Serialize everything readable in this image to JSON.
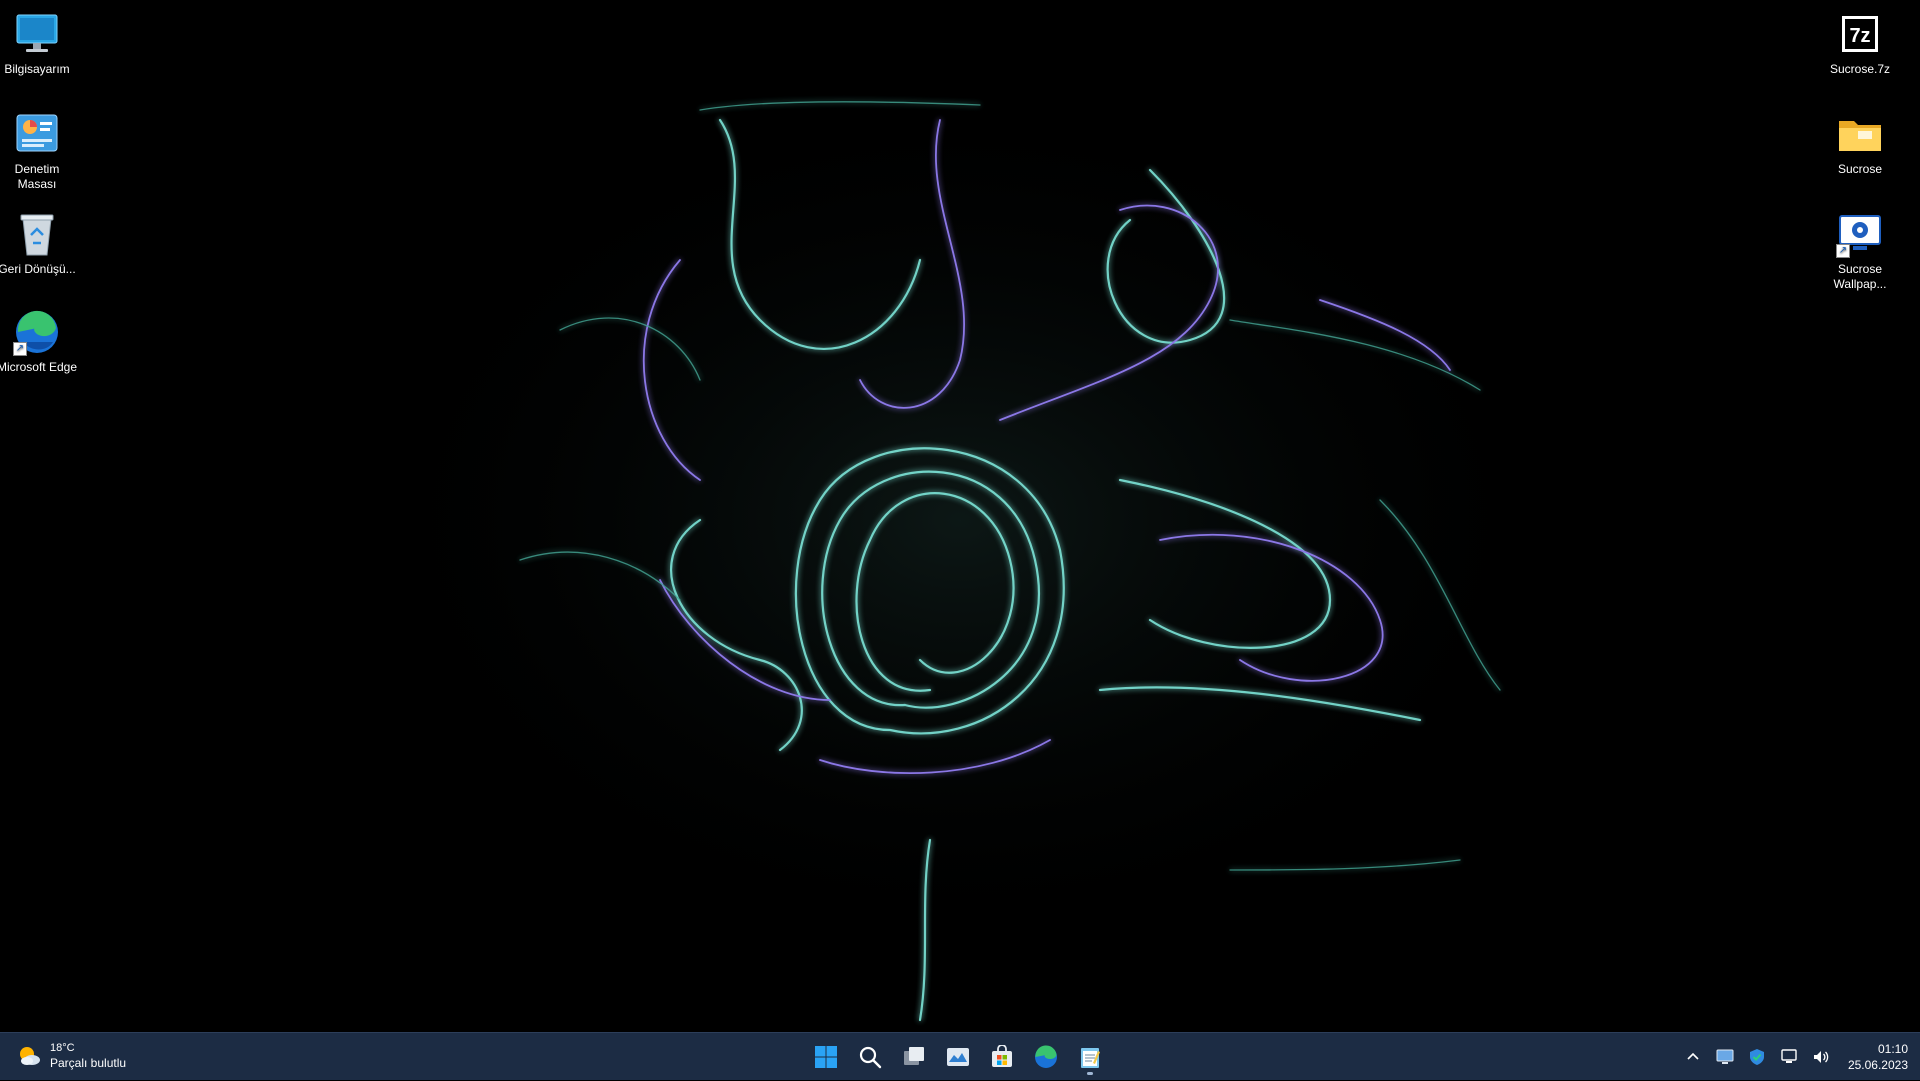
{
  "desktop": {
    "icons_left": [
      {
        "name": "this-pc-icon",
        "label": "Bilgisayarım"
      },
      {
        "name": "control-panel-icon",
        "label": "Denetim Masası"
      },
      {
        "name": "recycle-bin-icon",
        "label": "Geri Dönüşü..."
      },
      {
        "name": "edge-shortcut-icon",
        "label": "Microsoft Edge"
      }
    ],
    "icons_right": [
      {
        "name": "archive-7z-icon",
        "label": "Sucrose.7z"
      },
      {
        "name": "folder-icon",
        "label": "Sucrose"
      },
      {
        "name": "sucrose-wallpaper-shortcut-icon",
        "label": "Sucrose Wallpap..."
      }
    ]
  },
  "taskbar": {
    "weather": {
      "temperature": "18°C",
      "condition": "Parçalı bulutlu"
    },
    "apps": [
      {
        "name": "start-button",
        "icon": "windows-logo-icon"
      },
      {
        "name": "search-button",
        "icon": "search-icon"
      },
      {
        "name": "task-view-button",
        "icon": "task-view-icon"
      },
      {
        "name": "widgets-button",
        "icon": "widgets-icon"
      },
      {
        "name": "store-button",
        "icon": "microsoft-store-icon"
      },
      {
        "name": "edge-button",
        "icon": "edge-icon"
      },
      {
        "name": "notepad-button",
        "icon": "notepad-icon",
        "active": true
      }
    ],
    "tray": {
      "time": "01:10",
      "date": "25.06.2023"
    }
  },
  "colors": {
    "taskbar_bg": "#1c2c44",
    "wallpaper_line_cyan": "#5ee3d3",
    "wallpaper_line_violet": "#8f7bff"
  }
}
